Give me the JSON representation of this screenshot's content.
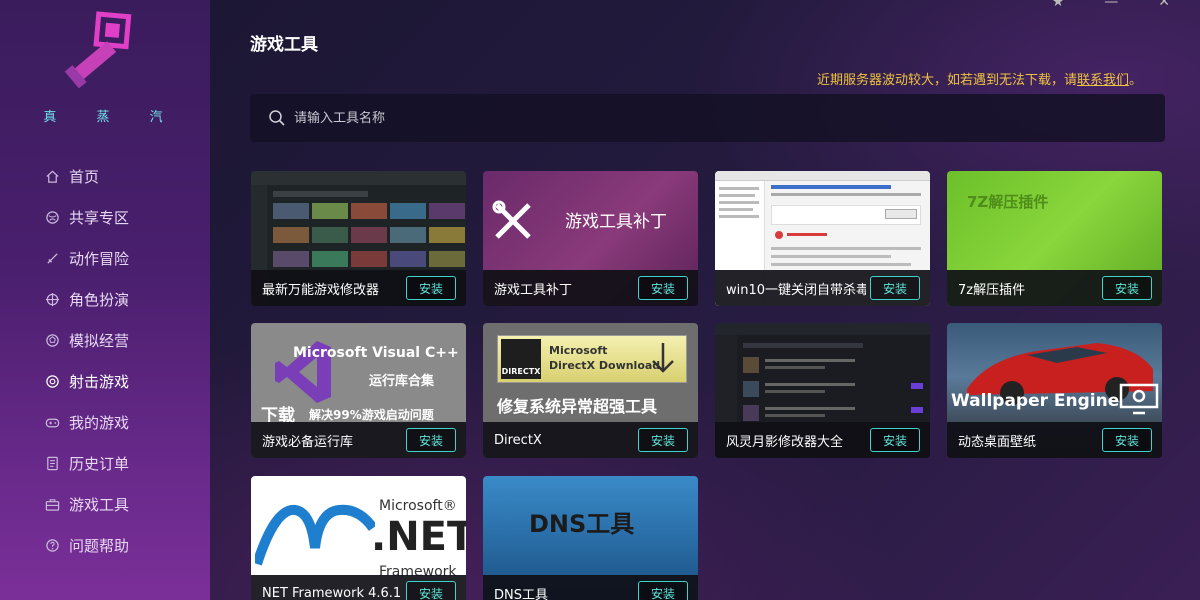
{
  "brand": {
    "name": "真 蒸 汽"
  },
  "sidebar": {
    "items": [
      {
        "label": "首页",
        "icon": "home-icon"
      },
      {
        "label": "共享专区",
        "icon": "share-icon"
      },
      {
        "label": "动作冒险",
        "icon": "sword-icon"
      },
      {
        "label": "角色扮演",
        "icon": "crosshair-icon"
      },
      {
        "label": "模拟经营",
        "icon": "ball-icon"
      },
      {
        "label": "射击游戏",
        "icon": "target-icon"
      },
      {
        "label": "我的游戏",
        "icon": "gamepad-icon"
      },
      {
        "label": "历史订单",
        "icon": "document-icon"
      },
      {
        "label": "游戏工具",
        "icon": "toolbox-icon"
      },
      {
        "label": "问题帮助",
        "icon": "help-icon"
      }
    ],
    "active_index": 5
  },
  "header": {
    "title": "游戏工具",
    "notice_text": "近期服务器波动较大，如若遇到无法下载，请",
    "notice_link": "联系我们",
    "notice_end": "。"
  },
  "search": {
    "placeholder": "请输入工具名称"
  },
  "install_label": "安装",
  "tools": [
    {
      "name": "最新万能游戏修改器"
    },
    {
      "name": "游戏工具补丁",
      "thumb_text": "游戏工具补丁"
    },
    {
      "name": "win10一键关闭自带杀毒"
    },
    {
      "name": "7z解压插件",
      "thumb_text": "7Z解压插件"
    },
    {
      "name": "游戏必备运行库",
      "thumb_line1": "Microsoft Visual C++",
      "thumb_line2": "运行库合集",
      "thumb_line3": "下载",
      "thumb_line4": "解决99%游戏启动问题"
    },
    {
      "name": "DirectX",
      "thumb_line1": "Microsoft",
      "thumb_line2": "DirectX Download",
      "thumb_line3": "修复系统异常超强工具",
      "thumb_badge": "DIRECTX"
    },
    {
      "name": "风灵月影修改器大全"
    },
    {
      "name": "动态桌面壁纸",
      "thumb_text": "Wallpaper Engine"
    },
    {
      "name": "NET Framework 4.6.1...",
      "thumb_line1": "Microsoft®",
      "thumb_line2": ".NET",
      "thumb_line3": "Framework"
    },
    {
      "name": "DNS工具",
      "thumb_text": "DNS工具"
    }
  ],
  "colors": {
    "accent": "#3fd6c9",
    "notice": "#f0c341",
    "brand": "#6fe0e8"
  }
}
